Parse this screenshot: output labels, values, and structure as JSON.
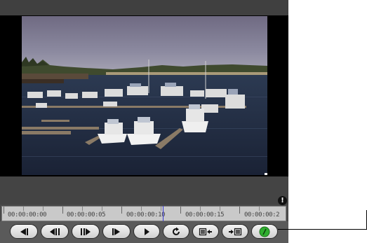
{
  "player": {
    "warning_icon": "exclamation-icon",
    "warning_glyph": "!",
    "timeline": {
      "timecodes": [
        "00:00:00:00",
        "00:00:00:05",
        "00:00:00:10",
        "00:00:00:15",
        "00:00:00:2"
      ],
      "playhead_timecode": "00:00:00:10"
    },
    "controls": [
      {
        "name": "go-to-start-button",
        "icon": "skip-to-start-icon"
      },
      {
        "name": "step-back-button",
        "icon": "step-backward-icon"
      },
      {
        "name": "step-forward-button",
        "icon": "step-forward-icon"
      },
      {
        "name": "go-to-end-button",
        "icon": "skip-to-end-icon"
      },
      {
        "name": "play-button",
        "icon": "play-icon"
      },
      {
        "name": "loop-button",
        "icon": "loop-icon"
      },
      {
        "name": "mark-in-button",
        "icon": "mark-in-icon"
      },
      {
        "name": "mark-out-button",
        "icon": "mark-out-icon"
      },
      {
        "name": "toggle-button",
        "icon": "green-indicator-icon"
      }
    ],
    "colors": {
      "accent_green": "#2fae2f",
      "playhead": "#3b3bd6"
    }
  }
}
